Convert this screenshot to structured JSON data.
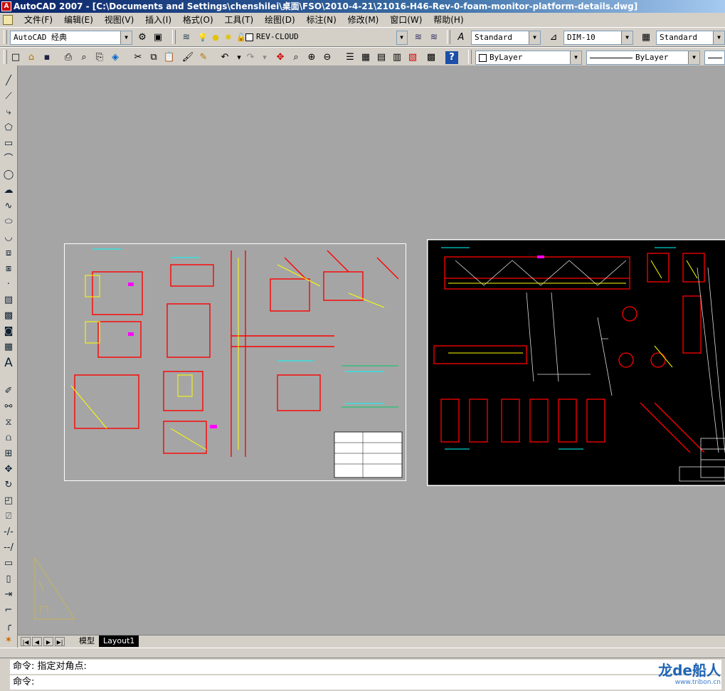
{
  "window": {
    "title": "AutoCAD 2007 - [C:\\Documents and Settings\\chenshilei\\桌面\\FSO\\2010-4-21\\21016-H46-Rev-0-foam-monitor-platform-details.dwg]"
  },
  "menu": [
    "文件(F)",
    "编辑(E)",
    "视图(V)",
    "插入(I)",
    "格式(O)",
    "工具(T)",
    "绘图(D)",
    "标注(N)",
    "修改(M)",
    "窗口(W)",
    "帮助(H)"
  ],
  "toolbar": {
    "workspace": "AutoCAD 经典",
    "layer": "REV-CLOUD",
    "text_style": "Standard",
    "dim_style": "DIM-10",
    "table_style": "Standard",
    "color": "ByLayer",
    "linetype": "ByLayer"
  },
  "tabs": [
    "模型",
    "Layout1"
  ],
  "active_tab": "Layout1",
  "command": {
    "line1": "命令: 指定对角点:",
    "line2": "命令:"
  },
  "watermark": {
    "text": "龙de船人",
    "url": "www.tribon.cn"
  },
  "colors": {
    "titlebar": "#0a246a",
    "canvas": "#a5a5a5",
    "cad_red": "#ff0000",
    "cad_yellow": "#ffff00",
    "cad_cyan": "#00ffff",
    "cad_magenta": "#ff00ff"
  }
}
